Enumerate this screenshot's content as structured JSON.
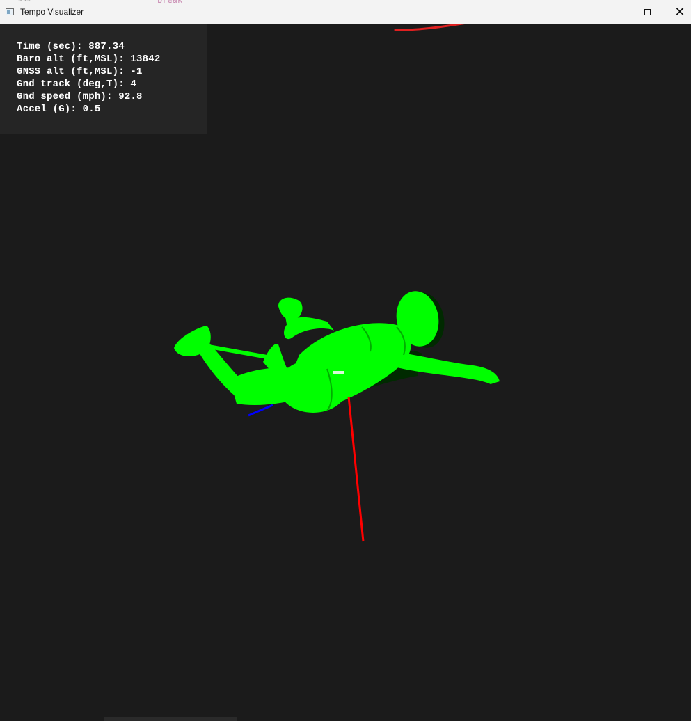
{
  "window": {
    "title": "Tempo Visualizer",
    "controls": {
      "minimize": "minimize-icon",
      "maximize": "maximize-icon",
      "close": "✕"
    }
  },
  "hud": {
    "time": "Time (sec): 887.34",
    "baro_alt": "Baro alt (ft,MSL): 13842",
    "gnss_alt": "GNSS alt (ft,MSL): -1",
    "gnd_track": "Gnd track (deg,T): 4",
    "gnd_speed": "Gnd speed (mph): 92.8",
    "accel": "Accel (G): 0.5"
  },
  "scene": {
    "model": "skydiver-figure",
    "model_color": "#00ff00",
    "axis_colors": {
      "x": "#ff0000",
      "y": "#0000ff"
    },
    "background": "#1b1b1b"
  },
  "annotation": {
    "color": "#e02020"
  }
}
